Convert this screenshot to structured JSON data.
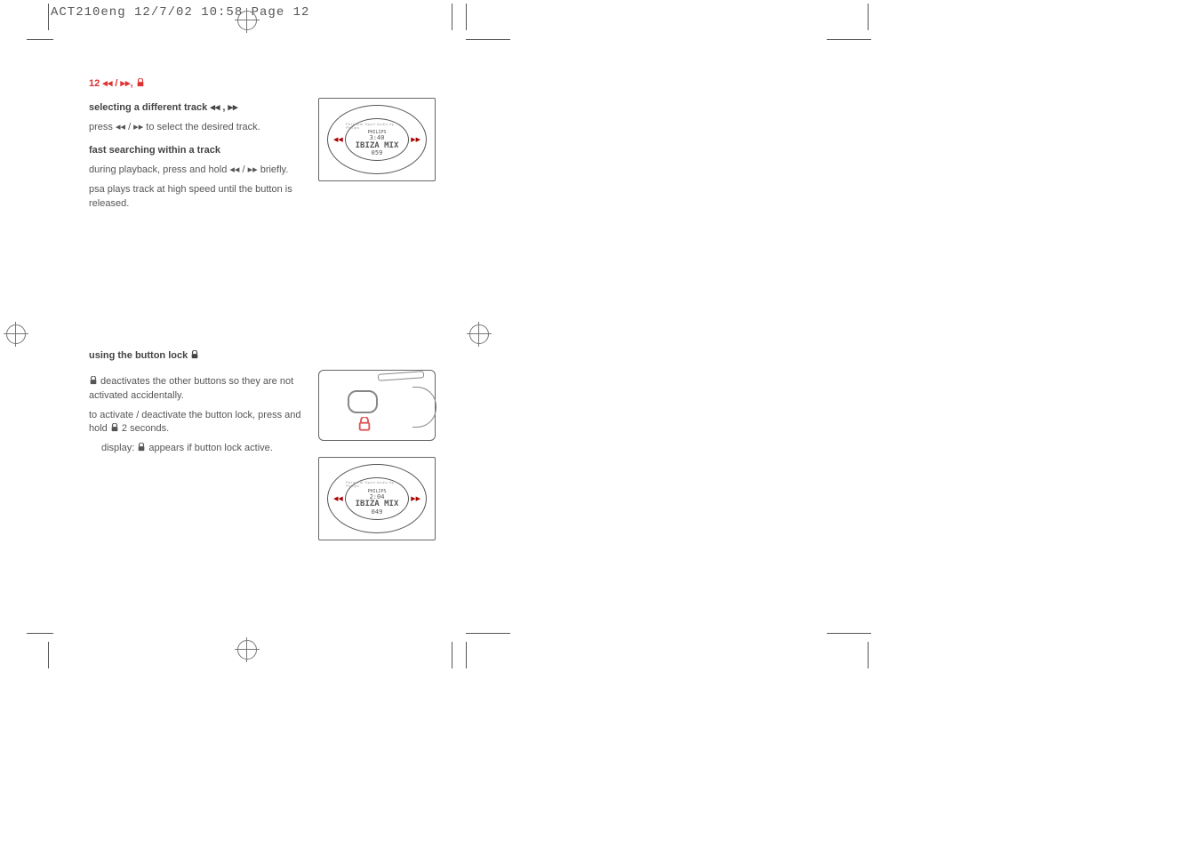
{
  "slug": "ACT210eng  12/7/02  10:58  Page 12",
  "left": {
    "header_prefix": "12 ",
    "header_glyphs": "◂◂ / ▸▸,  ",
    "sec1": {
      "heading_text": "selecting a different track ",
      "heading_glyphs": "◂◂ , ▸▸",
      "body_a": "press ",
      "body_glyphs": "◂◂ / ▸▸",
      "body_b": " to select the desired track."
    },
    "sec2": {
      "heading": "fast searching within a track",
      "body_a": "during playback, press and hold ",
      "body_glyphs": "◂◂ / ▸▸",
      "body_b": " briefly.",
      "body2": "psa plays track at high speed until the button is released."
    },
    "sec3": {
      "heading": "using the button lock ",
      "body1": " deactivates the other buttons so they are not activated accidentally.",
      "body2_a": "to activate / deactivate the button lock, press and hold ",
      "body2_b": " 2 seconds.",
      "body3_a": "display: ",
      "body3_b": " appears if button lock active."
    },
    "device1": {
      "arc": "Personal Sport Audio by Philips",
      "brand": "PHILIPS",
      "time": "3:40",
      "title": "IBIZA MIX",
      "track": "059"
    },
    "device2": {
      "arc": "Personal Sport Audio by Philips",
      "brand": "PHILIPS",
      "time": "2:04",
      "title": "IBIZA MIX",
      "track": "049"
    }
  }
}
